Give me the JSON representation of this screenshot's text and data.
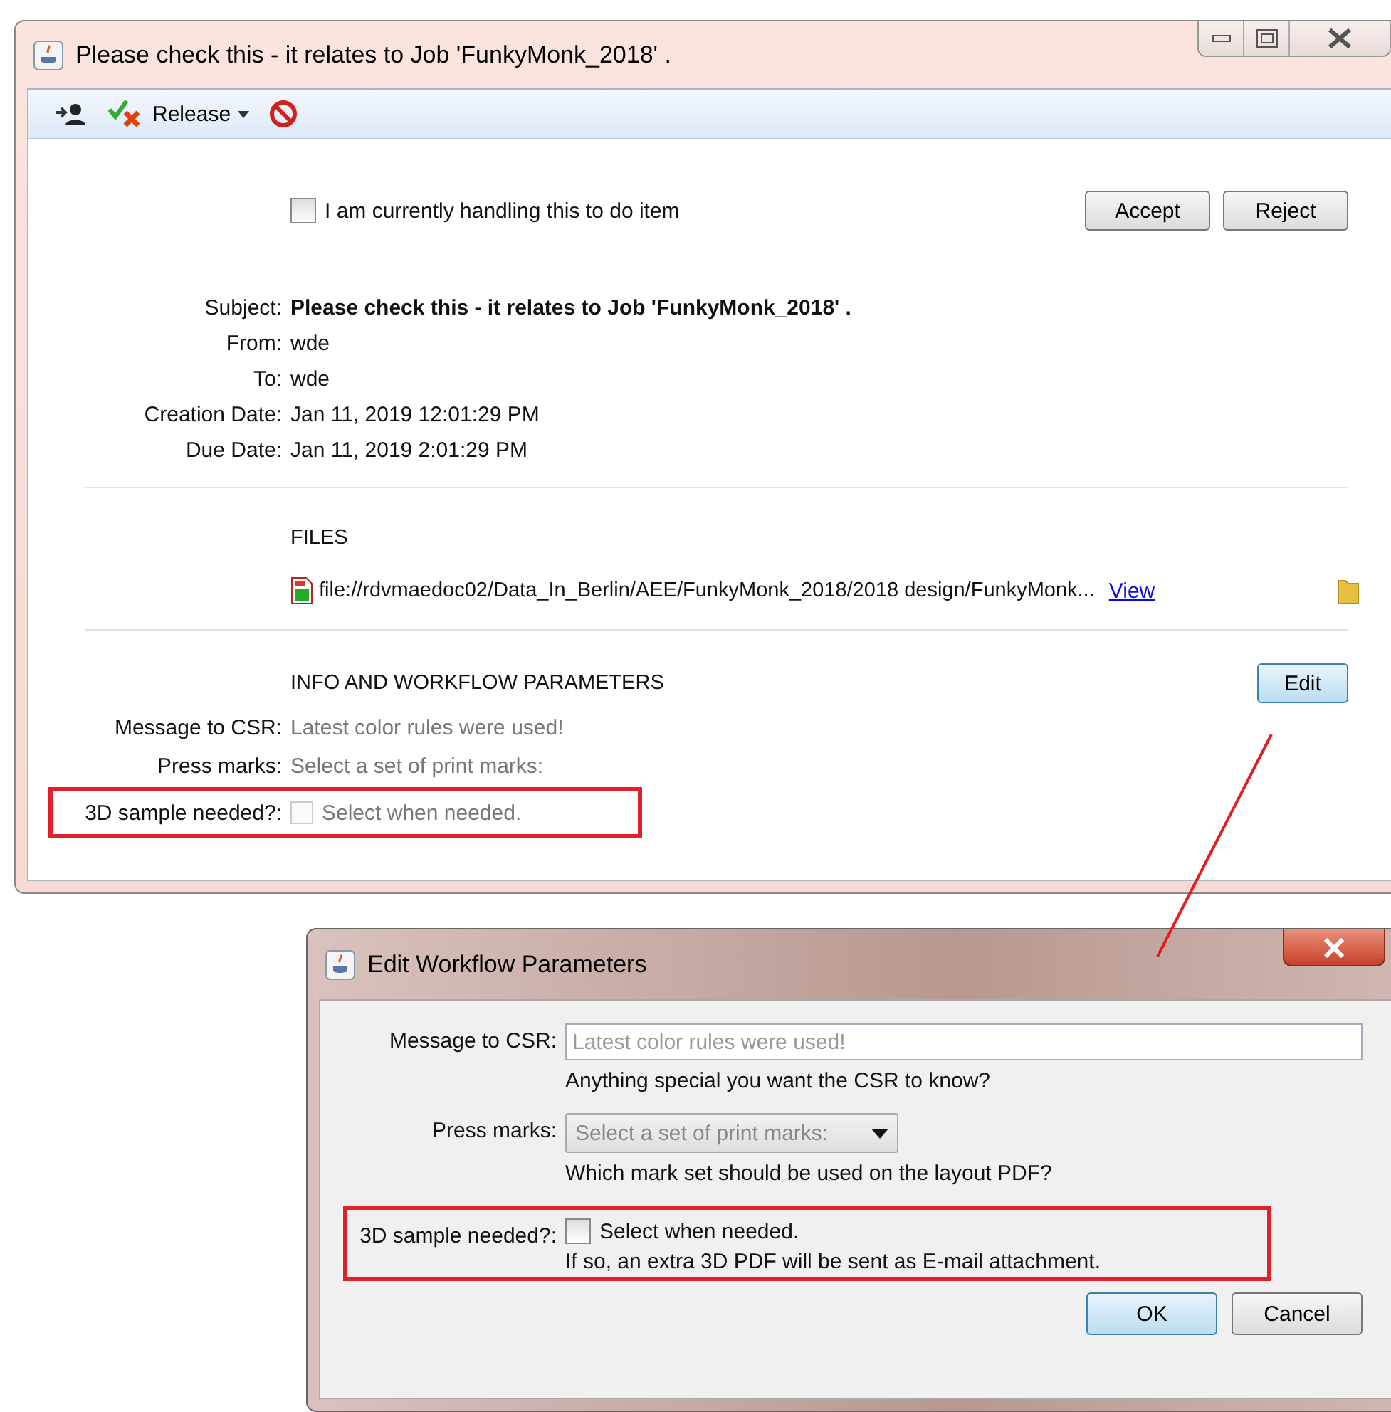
{
  "window": {
    "title": "Please check this - it relates to Job 'FunkyMonk_2018' ."
  },
  "toolbar": {
    "release_label": "Release"
  },
  "task": {
    "handling": {
      "label": "I am currently handling this to do item",
      "checked": false
    },
    "buttons": [
      "Accept",
      "Reject"
    ]
  },
  "details": [
    {
      "label": "Subject:",
      "value": "Please check this - it relates to Job 'FunkyMonk_2018' .",
      "bold": true
    },
    {
      "label": "From:",
      "value": "wde",
      "bold": false
    },
    {
      "label": "To:",
      "value": "wde",
      "bold": false
    },
    {
      "label": "Creation Date:",
      "value": "Jan 11, 2019 12:01:29 PM",
      "bold": false
    },
    {
      "label": "Due Date:",
      "value": "Jan 11, 2019 2:01:29 PM",
      "bold": false
    }
  ],
  "files": {
    "heading": "FILES",
    "items": [
      {
        "path": "file://rdvmaedoc02/Data_In_Berlin/AEE/FunkyMonk_2018/2018 design/FunkyMonk...",
        "link": "View"
      }
    ]
  },
  "parameters": {
    "heading": "INFO AND WORKFLOW PARAMETERS",
    "edit_button": "Edit",
    "rows": [
      {
        "label": "Message to CSR:",
        "kind": "text",
        "value": "Latest color rules were used!",
        "highlighted": false
      },
      {
        "label": "Press marks:",
        "kind": "text",
        "value": "Select a set of print marks:",
        "highlighted": false
      },
      {
        "label": "3D sample needed?:",
        "kind": "checkbox",
        "value": "Select when needed.",
        "checked": false,
        "highlighted": true
      }
    ]
  },
  "dialog": {
    "title": "Edit Workflow Parameters",
    "rows": [
      {
        "label": "Message to CSR:",
        "kind": "field",
        "placeholder": "Latest color rules were used!",
        "hint": "Anything special you want the CSR to know?",
        "highlighted": false
      },
      {
        "label": "Press marks:",
        "kind": "dropdown",
        "value": "Select a set of print marks:",
        "disabled": true,
        "hint": "Which mark set should be used on the layout PDF?",
        "highlighted": false
      },
      {
        "label": "3D sample needed?:",
        "kind": "checkbox",
        "value": "Select when needed.",
        "checked": false,
        "hint": "If so, an extra 3D PDF will be sent as E-mail attachment.",
        "highlighted": true
      }
    ],
    "buttons": [
      {
        "label": "OK",
        "default": true
      },
      {
        "label": "Cancel",
        "default": false
      }
    ]
  }
}
